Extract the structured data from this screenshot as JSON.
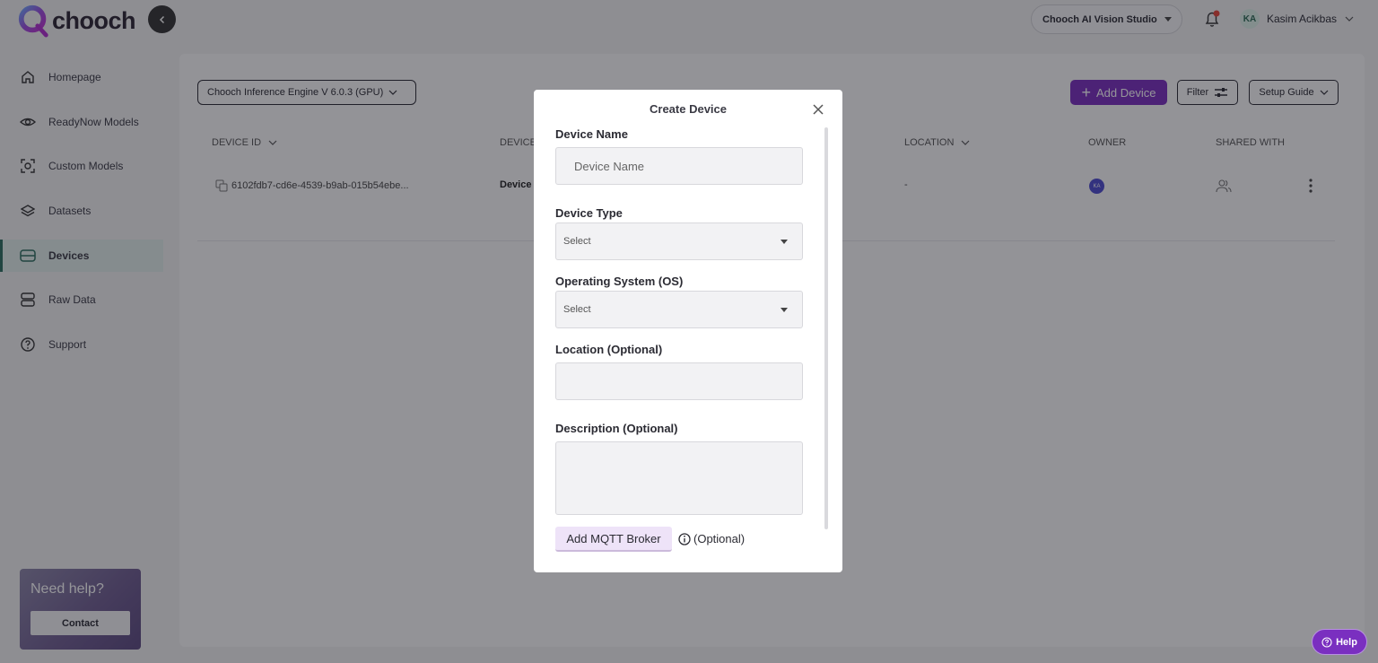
{
  "app": {
    "logo_text": "chooch"
  },
  "header": {
    "studio": "Chooch AI Vision Studio",
    "user_initials": "KA",
    "user_name": "Kasim Acikbas"
  },
  "sidebar": {
    "items": [
      {
        "label": "Homepage",
        "icon": "home-icon"
      },
      {
        "label": "ReadyNow Models",
        "icon": "eye-icon"
      },
      {
        "label": "Custom Models",
        "icon": "scan-icon"
      },
      {
        "label": "Datasets",
        "icon": "layers-icon"
      },
      {
        "label": "Devices",
        "icon": "device-icon",
        "active": true
      },
      {
        "label": "Raw Data",
        "icon": "database-icon"
      },
      {
        "label": "Support",
        "icon": "question-icon"
      }
    ],
    "help_title": "Need help?",
    "contact_label": "Contact"
  },
  "toolbar": {
    "engine": "Chooch Inference Engine V 6.0.3 (GPU)",
    "add_device": "Add Device",
    "filter": "Filter",
    "setup_guide": "Setup Guide"
  },
  "table": {
    "columns": [
      "DEVICE ID",
      "DEVICE",
      "LOCATION",
      "OWNER",
      "SHARED WITH"
    ],
    "rows": [
      {
        "device_id": "6102fdb7-cd6e-4539-b9ab-015b54ebe...",
        "device": "Device",
        "location": "-",
        "owner": "KA"
      }
    ]
  },
  "modal": {
    "title": "Create Device",
    "device_name_label": "Device Name",
    "device_name_placeholder": "Device Name",
    "device_type_label": "Device Type",
    "device_type_value": "Select",
    "os_label": "Operating System (OS)",
    "os_value": "Select",
    "location_label": "Location (Optional)",
    "description_label": "Description (Optional)",
    "mqtt_button": "Add MQTT Broker",
    "optional_text": "(Optional)"
  },
  "help_fab": "Help",
  "colors": {
    "accent": "#7a2fc0",
    "active_nav": "#2d6e5f"
  }
}
